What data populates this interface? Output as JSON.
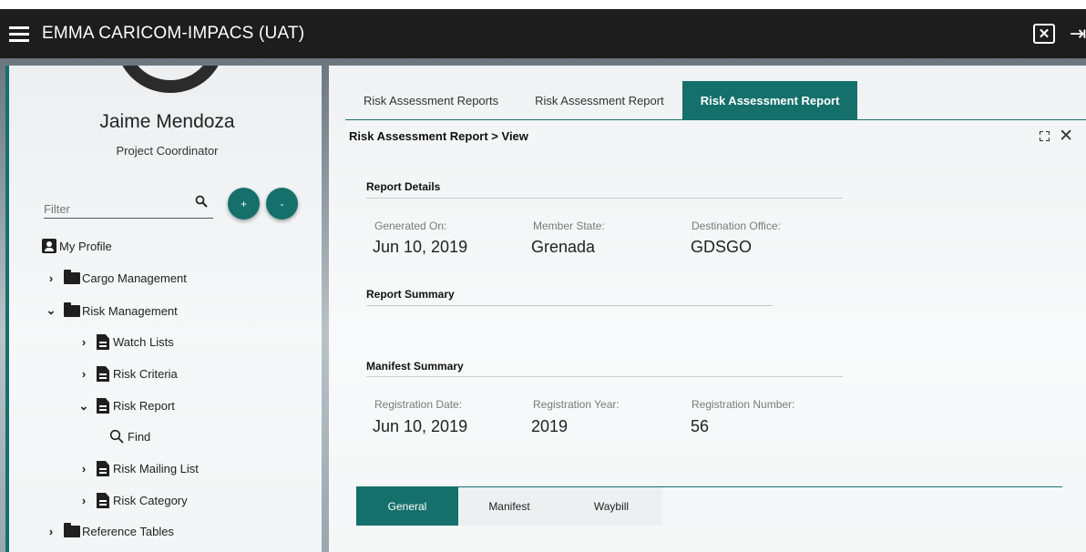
{
  "app": {
    "title": "EMMA CARICOM-IMPACS (UAT)"
  },
  "user": {
    "name": "Jaime Mendoza",
    "role": "Project Coordinator"
  },
  "sidebar": {
    "filter_placeholder": "Filter",
    "add_label": "+",
    "remove_label": "-",
    "items": [
      {
        "label": "My Profile"
      },
      {
        "label": "Cargo Management"
      },
      {
        "label": "Risk Management"
      },
      {
        "label": "Watch Lists"
      },
      {
        "label": "Risk Criteria"
      },
      {
        "label": "Risk Report"
      },
      {
        "label": "Find"
      },
      {
        "label": "Risk Mailing List"
      },
      {
        "label": "Risk Category"
      },
      {
        "label": "Reference Tables"
      }
    ]
  },
  "main": {
    "tabs": [
      {
        "label": "Risk Assessment Reports"
      },
      {
        "label": "Risk Assessment Report"
      },
      {
        "label": "Risk Assessment Report",
        "active": true
      }
    ],
    "view_title": "Risk Assessment Report > View",
    "report_details": {
      "title": "Report Details",
      "generated_on_label": "Generated On:",
      "generated_on": "Jun 10, 2019",
      "member_state_label": "Member State:",
      "member_state": "Grenada",
      "destination_office_label": "Destination Office:",
      "destination_office": "GDSGO"
    },
    "report_summary": {
      "title": "Report Summary"
    },
    "manifest_summary": {
      "title": "Manifest Summary",
      "registration_date_label": "Registration Date:",
      "registration_date": "Jun 10, 2019",
      "registration_year_label": "Registration Year:",
      "registration_year": "2019",
      "registration_number_label": "Registration Number:",
      "registration_number": "56"
    },
    "bottom_tabs": [
      {
        "label": "General",
        "active": true
      },
      {
        "label": "Manifest"
      },
      {
        "label": "Waybill"
      }
    ]
  },
  "colors": {
    "accent": "#15706c",
    "topbar": "#1d1d1d"
  }
}
